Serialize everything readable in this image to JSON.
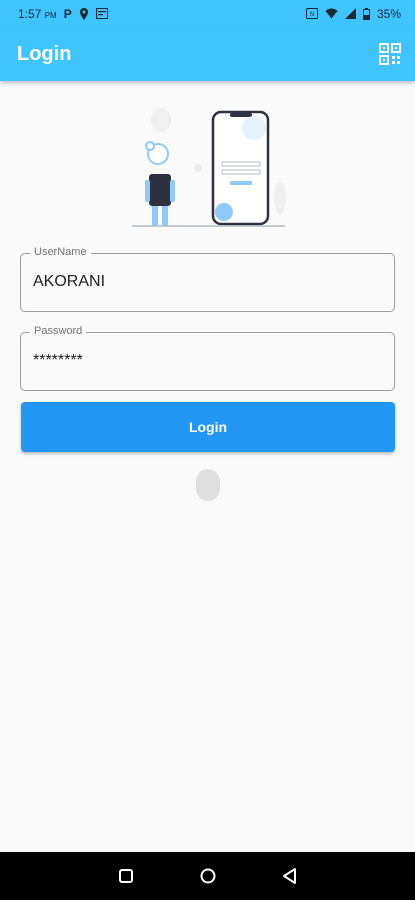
{
  "status_bar": {
    "time": "1:57",
    "ampm": "PM",
    "left_icons": [
      "p-icon",
      "location-icon",
      "calendar-icon"
    ],
    "right_icons": [
      "nfc-icon",
      "wifi-icon",
      "signal-icon",
      "battery-icon"
    ],
    "battery": "35%"
  },
  "app_bar": {
    "title": "Login",
    "action_icon": "qr-code-icon"
  },
  "form": {
    "username": {
      "label": "UserName",
      "value": "AKORANI"
    },
    "password": {
      "label": "Password",
      "value": "********"
    },
    "login_button": "Login"
  },
  "colors": {
    "app_bar": "#40c4ff",
    "button": "#2196f3",
    "background": "#fafafa"
  },
  "nav_bar": {
    "buttons": [
      "recents-icon",
      "home-icon",
      "back-icon"
    ]
  }
}
